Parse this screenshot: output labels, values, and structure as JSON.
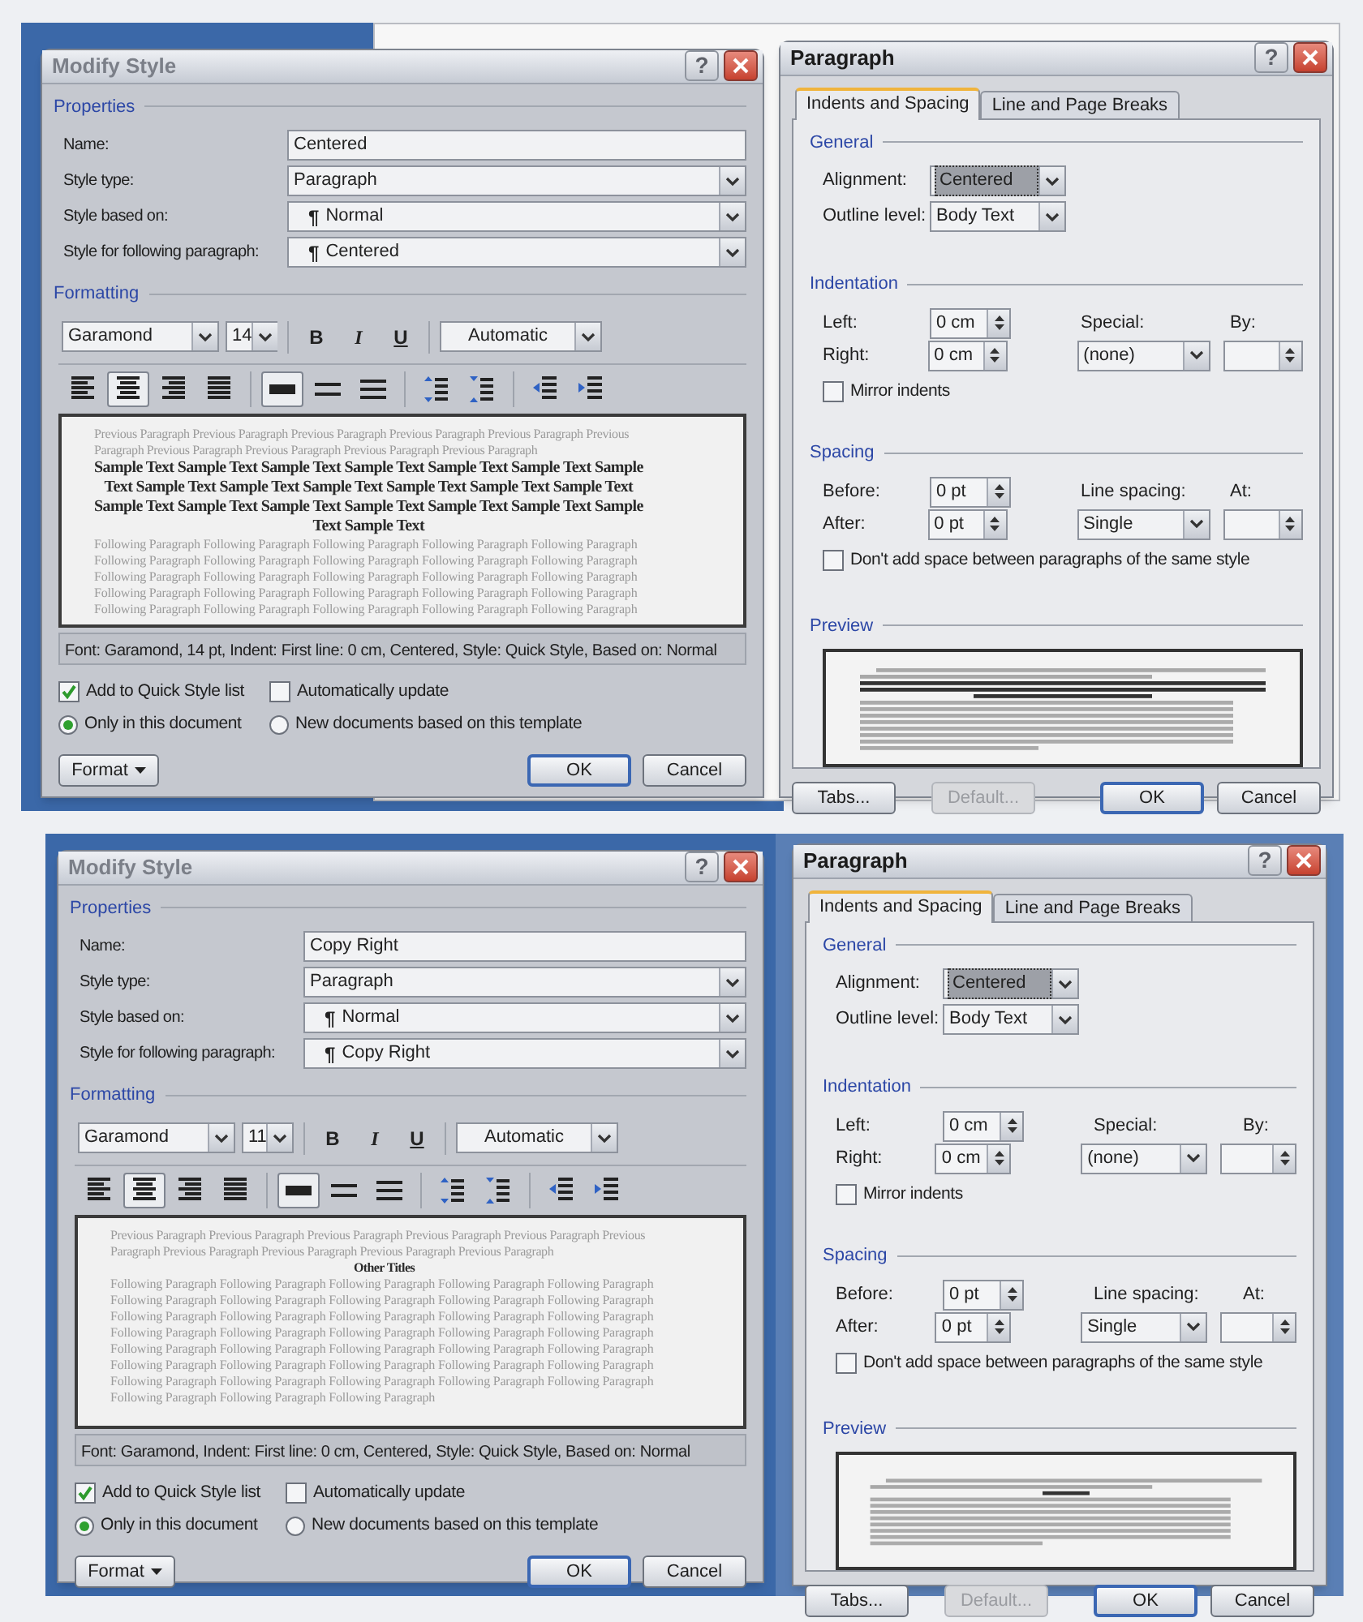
{
  "modify_style_dialogs": [
    {
      "title": "Modify Style",
      "active": false,
      "help_label": "?",
      "properties_heading": "Properties",
      "formatting_heading": "Formatting",
      "fields": [
        {
          "label": "Name:",
          "kind": "text",
          "value": "Centered"
        },
        {
          "label": "Style type:",
          "kind": "dropdown",
          "value": "Paragraph"
        },
        {
          "label": "Style based on:",
          "kind": "style_dropdown",
          "marker": "¶",
          "value": "Normal"
        },
        {
          "label": "Style for following paragraph:",
          "kind": "style_dropdown",
          "marker": "¶",
          "value": "Centered"
        }
      ],
      "font": "Garamond",
      "size": "14",
      "text_buttons": [
        {
          "label": "B",
          "kind": "bold"
        },
        {
          "label": "I",
          "kind": "italic"
        },
        {
          "label": "U",
          "kind": "underline"
        }
      ],
      "font_color_setting": "Automatic",
      "paragraph_buttons": [
        {
          "kind": "align_left",
          "selected": false
        },
        {
          "kind": "align_center",
          "selected": true
        },
        {
          "kind": "align_right",
          "selected": false
        },
        {
          "kind": "justify",
          "selected": false
        },
        {
          "kind": "single",
          "selected": true
        },
        {
          "kind": "one_half",
          "selected": false
        },
        {
          "kind": "double",
          "selected": false
        },
        {
          "kind": "space_increase",
          "selected": false
        },
        {
          "kind": "space_decrease",
          "selected": false
        },
        {
          "kind": "indent_decrease",
          "selected": false
        },
        {
          "kind": "indent_increase",
          "selected": false
        }
      ],
      "preview": {
        "previous": [
          "Previous Paragraph Previous Paragraph Previous Paragraph Previous Paragraph Previous Paragraph Previous",
          "Paragraph Previous Paragraph Previous Paragraph Previous Paragraph Previous Paragraph"
        ],
        "sample": [
          "Sample Text Sample Text Sample Text Sample Text Sample Text Sample Text Sample",
          "Text Sample Text Sample Text Sample Text Sample Text Sample Text Sample Text",
          "Sample Text Sample Text Sample Text Sample Text Sample Text Sample Text Sample",
          "Text Sample Text"
        ],
        "following": [
          "Following Paragraph Following Paragraph Following Paragraph Following Paragraph Following Paragraph",
          "Following Paragraph Following Paragraph Following Paragraph Following Paragraph Following Paragraph",
          "Following Paragraph Following Paragraph Following Paragraph Following Paragraph Following Paragraph",
          "Following Paragraph Following Paragraph Following Paragraph Following Paragraph Following Paragraph",
          "Following Paragraph Following Paragraph Following Paragraph Following Paragraph Following Paragraph"
        ]
      },
      "description": "Font: Garamond, 14 pt, Indent: First line:  0 cm, Centered, Style: Quick Style, Based on: Normal",
      "checkboxes": [
        {
          "label": "Add to Quick Style list",
          "checked": true
        },
        {
          "label": "Automatically update",
          "checked": false
        }
      ],
      "radios": [
        {
          "label": "Only in this document",
          "selected": true
        },
        {
          "label": "New documents based on this template",
          "selected": false
        }
      ],
      "format_button": "Format",
      "ok_button": "OK",
      "cancel_button": "Cancel"
    },
    {
      "title": "Modify Style",
      "active": false,
      "help_label": "?",
      "properties_heading": "Properties",
      "formatting_heading": "Formatting",
      "fields": [
        {
          "label": "Name:",
          "kind": "text",
          "value": "Copy Right"
        },
        {
          "label": "Style type:",
          "kind": "dropdown",
          "value": "Paragraph"
        },
        {
          "label": "Style based on:",
          "kind": "style_dropdown",
          "marker": "¶",
          "value": "Normal"
        },
        {
          "label": "Style for following paragraph:",
          "kind": "style_dropdown",
          "marker": "¶",
          "value": "Copy Right"
        }
      ],
      "font": "Garamond",
      "size": "11",
      "text_buttons": [
        {
          "label": "B",
          "kind": "bold"
        },
        {
          "label": "I",
          "kind": "italic"
        },
        {
          "label": "U",
          "kind": "underline"
        }
      ],
      "font_color_setting": "Automatic",
      "paragraph_buttons": [
        {
          "kind": "align_left",
          "selected": false
        },
        {
          "kind": "align_center",
          "selected": true
        },
        {
          "kind": "align_right",
          "selected": false
        },
        {
          "kind": "justify",
          "selected": false
        },
        {
          "kind": "single",
          "selected": true
        },
        {
          "kind": "one_half",
          "selected": false
        },
        {
          "kind": "double",
          "selected": false
        },
        {
          "kind": "space_increase",
          "selected": false
        },
        {
          "kind": "space_decrease",
          "selected": false
        },
        {
          "kind": "indent_decrease",
          "selected": false
        },
        {
          "kind": "indent_increase",
          "selected": false
        }
      ],
      "preview": {
        "previous": [
          "Previous Paragraph Previous Paragraph Previous Paragraph Previous Paragraph Previous Paragraph Previous",
          "Paragraph Previous Paragraph Previous Paragraph Previous Paragraph Previous Paragraph"
        ],
        "sample": [
          "Other Titles"
        ],
        "following": [
          "Following Paragraph Following Paragraph Following Paragraph Following Paragraph Following Paragraph",
          "Following Paragraph Following Paragraph Following Paragraph Following Paragraph Following Paragraph",
          "Following Paragraph Following Paragraph Following Paragraph Following Paragraph Following Paragraph",
          "Following Paragraph Following Paragraph Following Paragraph Following Paragraph Following Paragraph",
          "Following Paragraph Following Paragraph Following Paragraph Following Paragraph Following Paragraph",
          "Following Paragraph Following Paragraph Following Paragraph Following Paragraph Following Paragraph",
          "Following Paragraph Following Paragraph Following Paragraph Following Paragraph Following Paragraph",
          "Following Paragraph Following Paragraph Following Paragraph"
        ]
      },
      "description": "Font: Garamond, Indent: First line:  0 cm, Centered, Style: Quick Style, Based on: Normal",
      "checkboxes": [
        {
          "label": "Add to Quick Style list",
          "checked": true
        },
        {
          "label": "Automatically update",
          "checked": false
        }
      ],
      "radios": [
        {
          "label": "Only in this document",
          "selected": true
        },
        {
          "label": "New documents based on this template",
          "selected": false
        }
      ],
      "format_button": "Format",
      "ok_button": "OK",
      "cancel_button": "Cancel"
    }
  ],
  "paragraph_dialogs": [
    {
      "title": "Paragraph",
      "active": true,
      "help_label": "?",
      "tabs": [
        {
          "label": "Indents and Spacing",
          "selected": true
        },
        {
          "label": "Line and Page Breaks",
          "selected": false
        }
      ],
      "general": {
        "heading": "General",
        "alignment": {
          "label": "Alignment:",
          "value": "Centered",
          "focused": true
        },
        "outline_level": {
          "label": "Outline level:",
          "value": "Body Text",
          "focused": false
        }
      },
      "indentation": {
        "heading": "Indentation",
        "left": {
          "label": "Left:",
          "value": "0 cm"
        },
        "right": {
          "label": "Right:",
          "value": "0 cm"
        },
        "special": {
          "label": "Special:",
          "value": "(none)"
        },
        "by": {
          "label": "By:"
        },
        "mirror": {
          "label": "Mirror indents",
          "checked": false
        }
      },
      "spacing": {
        "heading": "Spacing",
        "before": {
          "label": "Before:",
          "value": "0 pt"
        },
        "after": {
          "label": "After:",
          "value": "0 pt"
        },
        "line_spacing": {
          "label": "Line spacing:",
          "value": "Single"
        },
        "at": {
          "label": "At:"
        },
        "dont_add": {
          "label": "Don't add space between paragraphs of the same style",
          "checked": false
        }
      },
      "preview_heading": "Preview",
      "buttons": [
        {
          "label": "Tabs...",
          "disabled": false,
          "default": false
        },
        {
          "label": "Default...",
          "disabled": true,
          "default": false
        },
        {
          "label": "OK",
          "disabled": false,
          "default": true
        },
        {
          "label": "Cancel",
          "disabled": false,
          "default": false
        }
      ]
    },
    {
      "title": "Paragraph",
      "active": true,
      "help_label": "?",
      "tabs": [
        {
          "label": "Indents and Spacing",
          "selected": true
        },
        {
          "label": "Line and Page Breaks",
          "selected": false
        }
      ],
      "general": {
        "heading": "General",
        "alignment": {
          "label": "Alignment:",
          "value": "Centered",
          "focused": true
        },
        "outline_level": {
          "label": "Outline level:",
          "value": "Body Text",
          "focused": false
        }
      },
      "indentation": {
        "heading": "Indentation",
        "left": {
          "label": "Left:",
          "value": "0 cm"
        },
        "right": {
          "label": "Right:",
          "value": "0 cm"
        },
        "special": {
          "label": "Special:",
          "value": "(none)"
        },
        "by": {
          "label": "By:"
        },
        "mirror": {
          "label": "Mirror indents",
          "checked": false
        }
      },
      "spacing": {
        "heading": "Spacing",
        "before": {
          "label": "Before:",
          "value": "0 pt"
        },
        "after": {
          "label": "After:",
          "value": "0 pt"
        },
        "line_spacing": {
          "label": "Line spacing:",
          "value": "Single"
        },
        "at": {
          "label": "At:"
        },
        "dont_add": {
          "label": "Don't add space between paragraphs of the same style",
          "checked": false
        }
      },
      "preview_heading": "Preview",
      "buttons": [
        {
          "label": "Tabs...",
          "disabled": false,
          "default": false
        },
        {
          "label": "Default...",
          "disabled": true,
          "default": false
        },
        {
          "label": "OK",
          "disabled": false,
          "default": true
        },
        {
          "label": "Cancel",
          "disabled": false,
          "default": false
        }
      ]
    }
  ]
}
